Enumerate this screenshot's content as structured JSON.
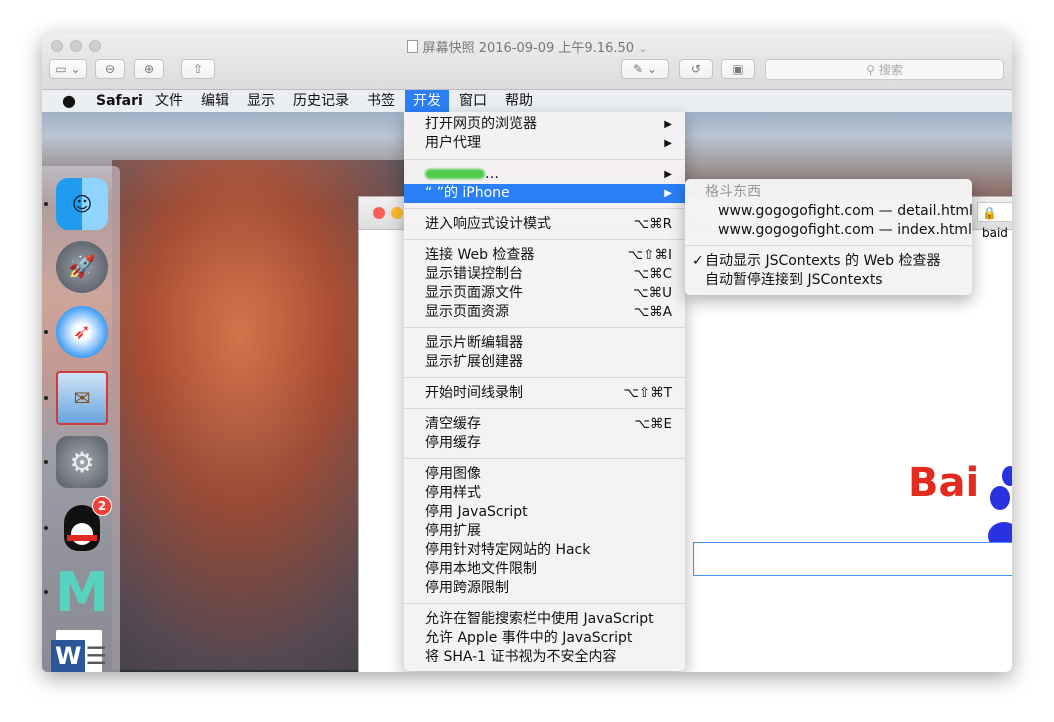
{
  "window": {
    "title": "屏幕快照 2016-09-09 上午9.16.50",
    "title_chevron": "⌄",
    "search_placeholder": "搜索"
  },
  "menubar": {
    "apple": "",
    "items": [
      "Safari",
      "文件",
      "编辑",
      "显示",
      "历史记录",
      "书签",
      "开发",
      "窗口",
      "帮助"
    ],
    "active_index": 6
  },
  "develop_menu": {
    "items": [
      {
        "label": "打开网页的浏览器",
        "submenu": true
      },
      {
        "label": "用户代理",
        "submenu": true
      },
      {
        "label": "…",
        "submenu": true
      },
      {
        "label": "“    ”的 iPhone",
        "submenu": true,
        "highlighted": true
      },
      {
        "label": "进入响应式设计模式",
        "shortcut": "⌥⌘R"
      },
      {
        "label": "连接 Web 检查器",
        "shortcut": "⌥⇧⌘I"
      },
      {
        "label": "显示错误控制台",
        "shortcut": "⌥⌘C"
      },
      {
        "label": "显示页面源文件",
        "shortcut": "⌥⌘U"
      },
      {
        "label": "显示页面资源",
        "shortcut": "⌥⌘A"
      },
      {
        "label": "显示片断编辑器"
      },
      {
        "label": "显示扩展创建器"
      },
      {
        "label": "开始时间线录制",
        "shortcut": "⌥⇧⌘T"
      },
      {
        "label": "清空缓存",
        "shortcut": "⌥⌘E"
      },
      {
        "label": "停用缓存"
      },
      {
        "label": "停用图像"
      },
      {
        "label": "停用样式"
      },
      {
        "label": "停用 JavaScript"
      },
      {
        "label": "停用扩展"
      },
      {
        "label": "停用针对特定网站的 Hack"
      },
      {
        "label": "停用本地文件限制"
      },
      {
        "label": "停用跨源限制"
      },
      {
        "label": "允许在智能搜索栏中使用 JavaScript"
      },
      {
        "label": "允许 Apple 事件中的 JavaScript"
      },
      {
        "label": "将 SHA-1 证书视为不安全内容"
      }
    ]
  },
  "iphone_submenu": {
    "header": "格斗东西",
    "pages": [
      "www.gogogofight.com — detail.html",
      "www.gogogofight.com — index.html"
    ],
    "options": [
      {
        "label": "自动显示 JSContexts 的 Web 检查器",
        "checked": true
      },
      {
        "label": "自动暂停连接到 JSContexts",
        "checked": false
      }
    ],
    "checkmark": "✓"
  },
  "dock": {
    "icons": [
      "finder-icon",
      "launchpad-icon",
      "safari-icon",
      "mail-icon",
      "system-preferences-icon",
      "qq-icon",
      "m-app-icon",
      "word-icon"
    ],
    "qq_badge": "2",
    "word_letter": "W",
    "m_letter": "M"
  },
  "browser_tab": {
    "label": "baid"
  },
  "baidu_logo": "Bai"
}
